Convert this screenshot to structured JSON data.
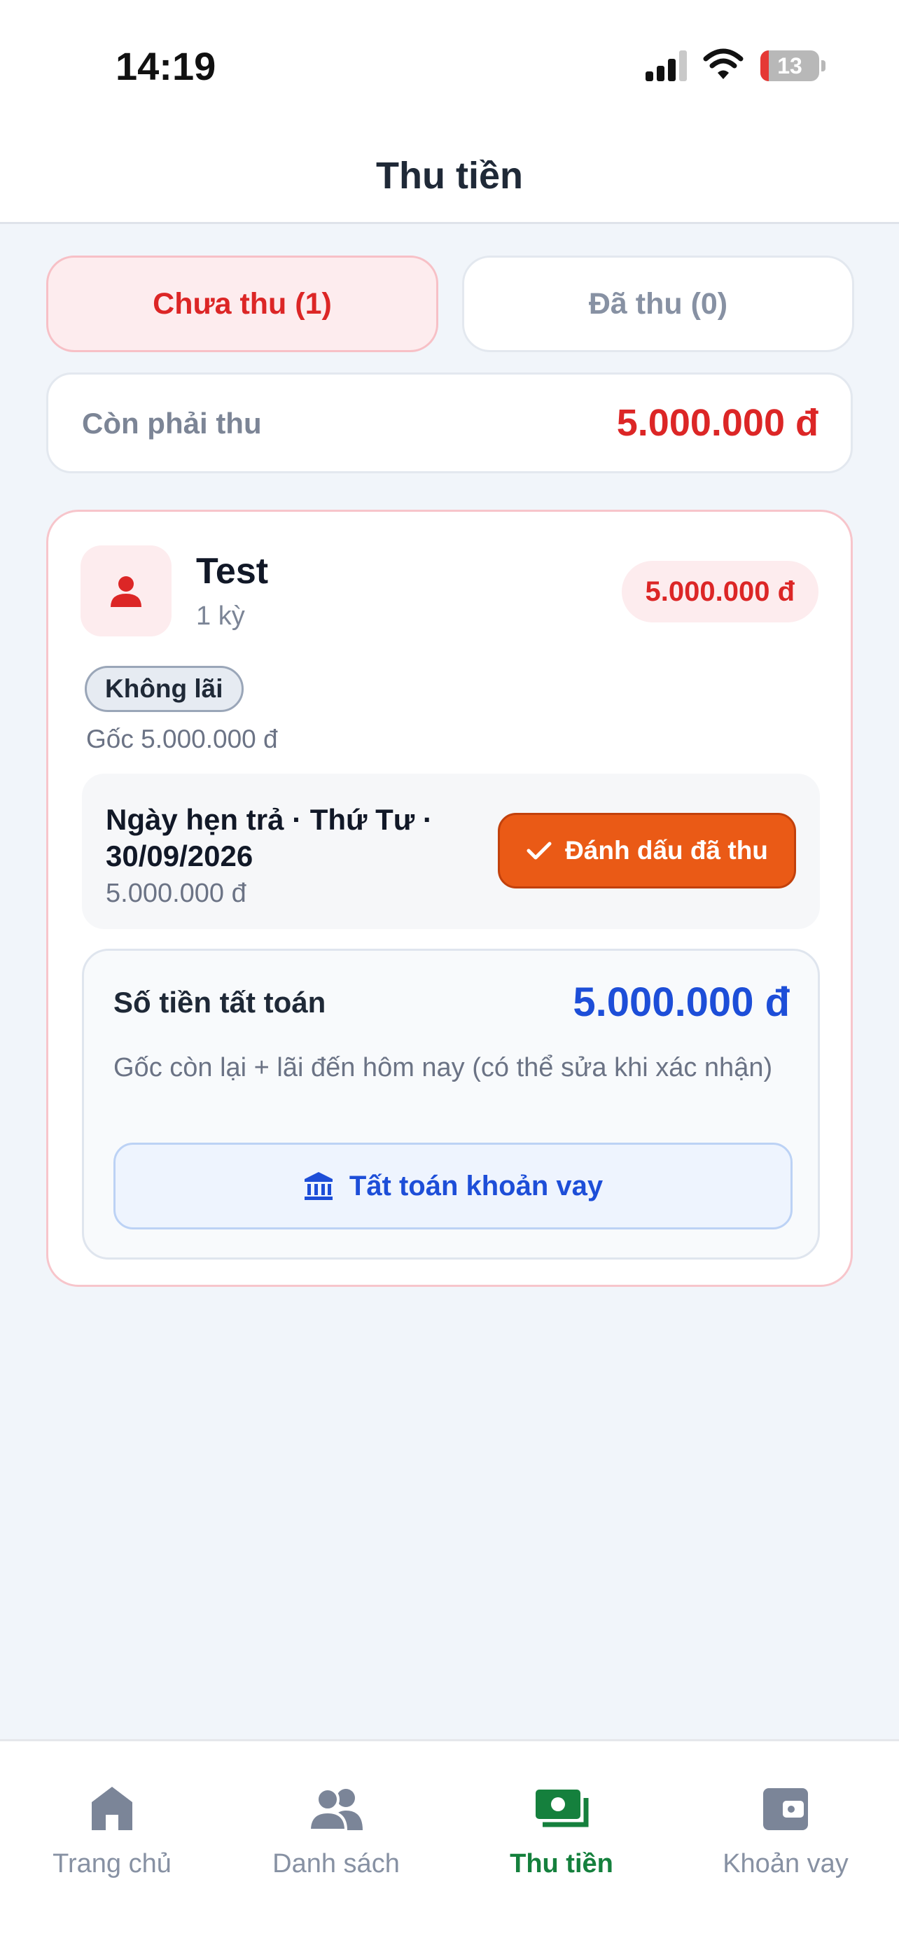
{
  "status_bar": {
    "time": "14:19",
    "battery": "13"
  },
  "header": {
    "title": "Thu tiền"
  },
  "tabs": [
    {
      "label": "Chưa thu (1)",
      "active": true
    },
    {
      "label": "Đã thu (0)",
      "active": false
    }
  ],
  "summary": {
    "label": "Còn phải thu",
    "value": "5.000.000 đ"
  },
  "loan": {
    "name": "Test",
    "periods": "1 kỳ",
    "amount": "5.000.000 đ",
    "badge": "Không lãi",
    "principal": "Gốc 5.000.000 đ",
    "due": {
      "title": "Ngày hẹn trả · Thứ Tư · 30/09/2026",
      "amount": "5.000.000 đ",
      "mark_button": "Đánh dấu đã thu"
    },
    "settlement": {
      "label": "Số tiền tất toán",
      "value": "5.000.000 đ",
      "description": "Gốc còn lại + lãi đến hôm nay (có thể sửa khi xác nhận)",
      "button": "Tất toán khoản vay"
    }
  },
  "bottom_nav": [
    {
      "label": "Trang chủ",
      "icon": "home-icon",
      "active": false
    },
    {
      "label": "Danh sách",
      "icon": "users-icon",
      "active": false
    },
    {
      "label": "Thu tiền",
      "icon": "cash-icon",
      "active": true
    },
    {
      "label": "Khoản vay",
      "icon": "wallet-icon",
      "active": false
    }
  ],
  "colors": {
    "accent_red": "#dc2626",
    "accent_orange": "#ea5a16",
    "accent_blue": "#1d4ed8",
    "accent_green": "#15803d"
  }
}
